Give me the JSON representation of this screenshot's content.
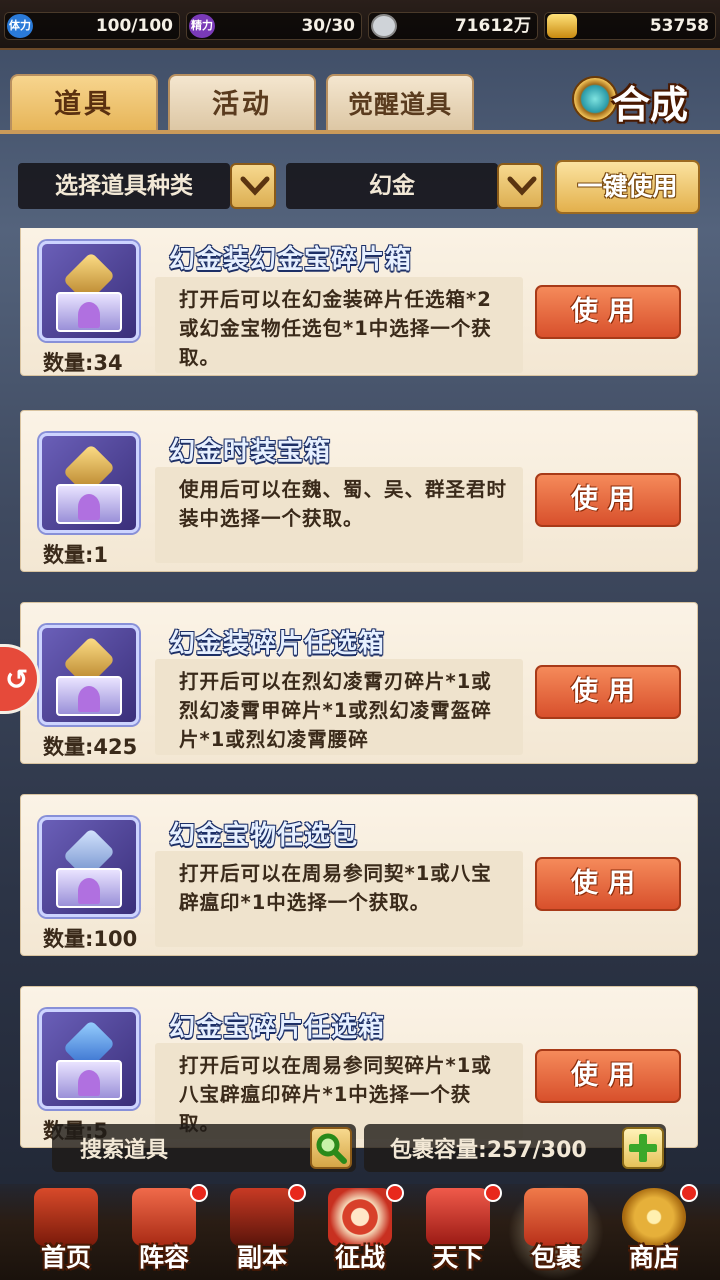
{
  "resources": {
    "stamina_icon": "体力",
    "stamina": "100/100",
    "energy_icon": "精力",
    "energy": "30/30",
    "coins": "71612万",
    "gold": "53758"
  },
  "tabs": [
    {
      "label": "道具",
      "active": true
    },
    {
      "label": "活动",
      "active": false
    },
    {
      "label": "觉醒道具",
      "active": false
    }
  ],
  "synthesize_label": "合成",
  "filter": {
    "category_label": "选择道具种类",
    "selected_type": "幻金",
    "use_all_label": "一键使用"
  },
  "items": [
    {
      "title": "幻金装幻金宝碎片箱",
      "desc": "打开后可以在幻金装碎片任选箱*2或幻金宝物任选包*1中选择一个获取。",
      "count": "数量:34",
      "use_label": "使用"
    },
    {
      "title": "幻金时装宝箱",
      "desc": "使用后可以在魏、蜀、吴、群圣君时装中选择一个获取。",
      "count": "数量:1",
      "use_label": "使用"
    },
    {
      "title": "幻金装碎片任选箱",
      "desc": "打开后可以在烈幻凌霄刃碎片*1或烈幻凌霄甲碎片*1或烈幻凌霄盔碎片*1或烈幻凌霄腰碎",
      "count": "数量:425",
      "use_label": "使用"
    },
    {
      "title": "幻金宝物任选包",
      "desc": "打开后可以在周易参同契*1或八宝辟瘟印*1中选择一个获取。",
      "count": "数量:100",
      "use_label": "使用"
    },
    {
      "title": "幻金宝碎片任选箱",
      "desc": "打开后可以在周易参同契碎片*1或八宝辟瘟印碎片*1中选择一个获取。",
      "count": "数量:5",
      "use_label": "使用"
    }
  ],
  "search": {
    "placeholder": "搜索道具"
  },
  "capacity": {
    "label": "包裹容量:257/300"
  },
  "nav": [
    {
      "label": "首页",
      "badge": false,
      "active": false,
      "color": "#c0392b"
    },
    {
      "label": "阵容",
      "badge": true,
      "active": false,
      "color": "#d9442e"
    },
    {
      "label": "副本",
      "badge": true,
      "active": false,
      "color": "#b8361e"
    },
    {
      "label": "征战",
      "badge": true,
      "active": false,
      "color": "#c94a2a"
    },
    {
      "label": "天下",
      "badge": true,
      "active": false,
      "color": "#d83a3a"
    },
    {
      "label": "包裹",
      "badge": false,
      "active": true,
      "color": "#d8402c"
    },
    {
      "label": "商店",
      "badge": true,
      "active": false,
      "color": "#d9a032"
    }
  ]
}
